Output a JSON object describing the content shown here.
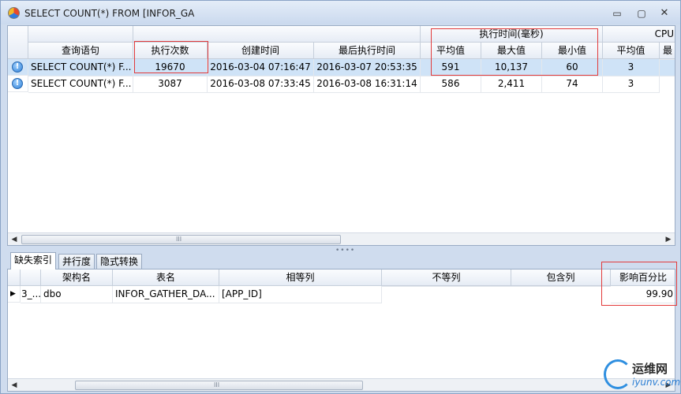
{
  "window": {
    "title": "SELECT COUNT(*) FROM [INFOR_GA"
  },
  "window_controls": {
    "minimize": "▭",
    "maximize": "▢",
    "close": "✕"
  },
  "top_table": {
    "group_headers": {
      "exec_time": "执行时间(毫秒)",
      "cpu": "CPU"
    },
    "columns": {
      "query": "查询语句",
      "exec_count": "执行次数",
      "created": "创建时间",
      "last_exec": "最后执行时间",
      "avg": "平均值",
      "max": "最大值",
      "min": "最小值",
      "cpu_avg": "平均值",
      "cpu_more": "最"
    },
    "rows": [
      {
        "query": "SELECT COUNT(*) F...",
        "exec_count": "19670",
        "created": "2016-03-04 07:16:47",
        "last_exec": "2016-03-07 20:53:35",
        "avg": "591",
        "max": "10,137",
        "min": "60",
        "cpu_avg": "3"
      },
      {
        "query": "SELECT COUNT(*) F...",
        "exec_count": "3087",
        "created": "2016-03-08 07:33:45",
        "last_exec": "2016-03-08 16:31:14",
        "avg": "586",
        "max": "2,411",
        "min": "74",
        "cpu_avg": "3"
      }
    ],
    "scroll_thumb_grip": "III"
  },
  "tabs": [
    "缺失索引",
    "并行度",
    "隐式转换"
  ],
  "bottom_table": {
    "columns": {
      "schema": "架构名",
      "table": "表名",
      "equality": "相等列",
      "inequality": "不等列",
      "include": "包含列",
      "impact": "影响百分比"
    },
    "rows": [
      {
        "rowid": "3_...",
        "schema": "dbo",
        "table": "INFOR_GATHER_DA...",
        "equality": "[APP_ID]",
        "inequality": "",
        "include": "",
        "impact": "99.90"
      }
    ],
    "scroll_thumb_grip": "III"
  },
  "watermark": {
    "cn": "运维网",
    "en": "iyunv.com"
  },
  "colors": {
    "highlight_box": "#e23b3b",
    "selected_row": "#cfe3f7"
  }
}
